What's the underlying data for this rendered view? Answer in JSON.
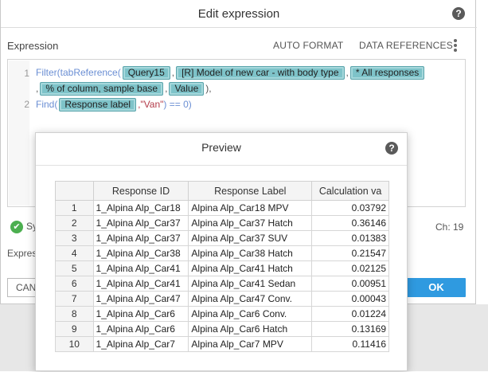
{
  "dialog": {
    "title": "Edit expression",
    "help": "?",
    "expression_label": "Expression",
    "auto_format": "AUTO FORMAT",
    "data_references": "DATA REFERENCES",
    "status": "Sy",
    "char_count": "Ch:  19",
    "expressions_label": "Expres",
    "cancel": "CAN",
    "ok": "OK"
  },
  "code": {
    "line1_no": "1",
    "line2_no": "2",
    "l1_fn": "Filter(tabReference(",
    "chip_query": "Query15",
    "sep1": ",",
    "chip_model": "[R] Model of new car - with body type",
    "sep2": ",",
    "chip_all": "* All responses",
    "l1b_sep": ",",
    "chip_pct": "% of column, sample base",
    "sep3": ",",
    "chip_value": "Value",
    "l1b_end": "),",
    "l2_fn": "Find(",
    "chip_label": "Response label",
    "l2_str": ",\"Van\"",
    "l2_end": ") == 0)"
  },
  "preview": {
    "title": "Preview",
    "help": "?",
    "columns": [
      "",
      "Response ID",
      "Response Label",
      "Calculation va"
    ],
    "rows": [
      [
        "1",
        "1_Alpina Alp_Car18",
        "Alpina Alp_Car18 MPV",
        "0.03792"
      ],
      [
        "2",
        "1_Alpina Alp_Car37",
        "Alpina Alp_Car37 Hatch",
        "0.36146"
      ],
      [
        "3",
        "1_Alpina Alp_Car37",
        "Alpina Alp_Car37 SUV",
        "0.01383"
      ],
      [
        "4",
        "1_Alpina Alp_Car38",
        "Alpina Alp_Car38 Hatch",
        "0.21547"
      ],
      [
        "5",
        "1_Alpina Alp_Car41",
        "Alpina Alp_Car41 Hatch",
        "0.02125"
      ],
      [
        "6",
        "1_Alpina Alp_Car41",
        "Alpina Alp_Car41 Sedan",
        "0.00951"
      ],
      [
        "7",
        "1_Alpina Alp_Car47",
        "Alpina Alp_Car47 Conv.",
        "0.00043"
      ],
      [
        "8",
        "1_Alpina Alp_Car6",
        "Alpina Alp_Car6 Conv.",
        "0.01224"
      ],
      [
        "9",
        "1_Alpina Alp_Car6",
        "Alpina Alp_Car6 Hatch",
        "0.13169"
      ],
      [
        "10",
        "1_Alpina Alp_Car7",
        "Alpina Alp_Car7 MPV",
        "0.11416"
      ]
    ]
  },
  "icons": {
    "status": "check-circle-icon"
  },
  "colors": {
    "chip": "#7ec3c9",
    "ok": "#2f9ae0",
    "function": "#6b8fd4",
    "string": "#b23a48"
  }
}
